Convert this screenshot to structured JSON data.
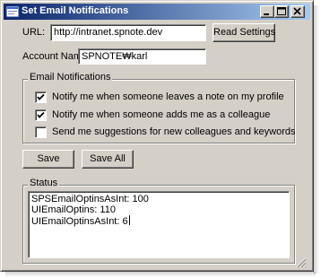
{
  "window": {
    "title": "Set Email Notifications"
  },
  "form": {
    "url_label": "URL:",
    "url_value": "http://intranet.spnote.dev",
    "read_settings_label": "Read Settings",
    "account_label": "Account Name:",
    "account_value": "SPNOTE₩karl"
  },
  "email_notifications": {
    "title": "Email Notifications",
    "options": [
      {
        "label": "Notify me when someone leaves a note on my profile",
        "checked": true
      },
      {
        "label": "Notify me when someone adds me as a colleague",
        "checked": true
      },
      {
        "label": "Send me suggestions for new colleagues and keywords",
        "checked": false
      }
    ]
  },
  "actions": {
    "save_label": "Save",
    "save_all_label": "Save All"
  },
  "status": {
    "title": "Status",
    "lines": [
      "SPSEmailOptinsAsInt: 100",
      "UIEmailOptins: 110",
      "UIEmailOptinsAsInt: 6"
    ]
  }
}
